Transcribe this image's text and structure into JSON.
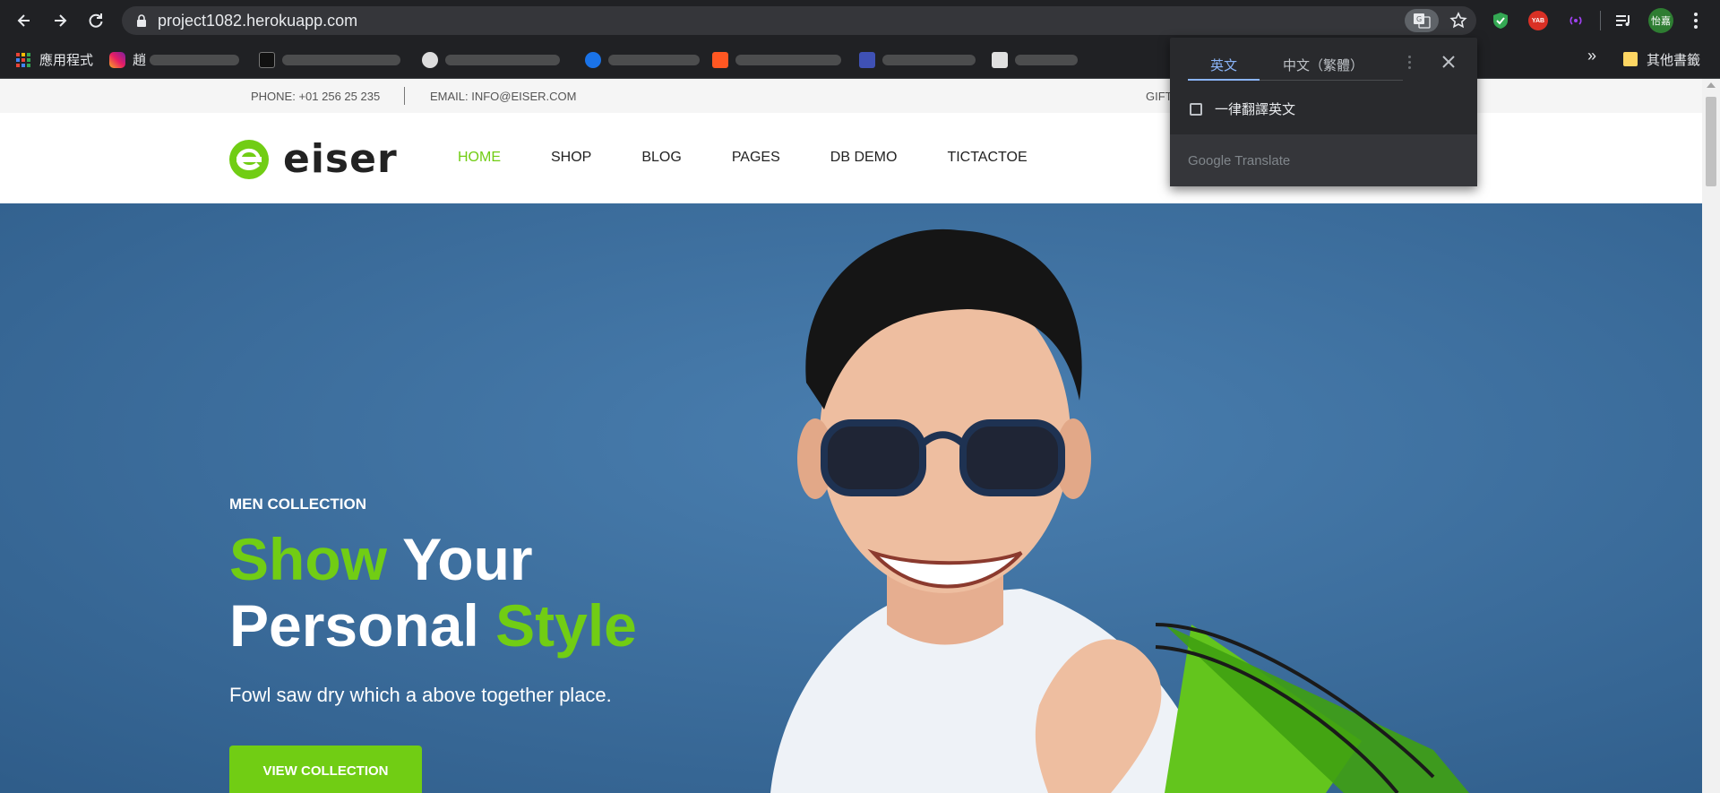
{
  "browser": {
    "url": "project1082.herokuapp.com",
    "profile_initials": "怡嘉",
    "ext_badge": "YAB"
  },
  "bookmarks": {
    "apps_label": "應用程式",
    "item1_visible_char": "趙",
    "other_label": "其他書籤",
    "overflow": "»"
  },
  "topbar": {
    "phone": "PHONE: +01 256 25 235",
    "email": "EMAIL: INFO@EISER.COM",
    "gift": "GIFT"
  },
  "site": {
    "logo_text": "eiser",
    "menu": [
      "HOME",
      "SHOP",
      "BLOG",
      "PAGES",
      "DB DEMO",
      "TICTACTOE"
    ]
  },
  "hero": {
    "eyebrow": "MEN COLLECTION",
    "headline_w1": "Show",
    "headline_w2": "Your",
    "headline_w3": "Personal",
    "headline_w4": "Style",
    "subtitle": "Fowl saw dry which a above together place.",
    "cta": "VIEW COLLECTION"
  },
  "translate_popup": {
    "tab_source": "英文",
    "tab_target": "中文（繁體）",
    "always_translate": "一律翻譯英文",
    "brand": "Google Translate"
  },
  "colors": {
    "accent": "#71cd14",
    "hero_bg": "#3d6f9e",
    "chrome_dark": "#202124"
  }
}
